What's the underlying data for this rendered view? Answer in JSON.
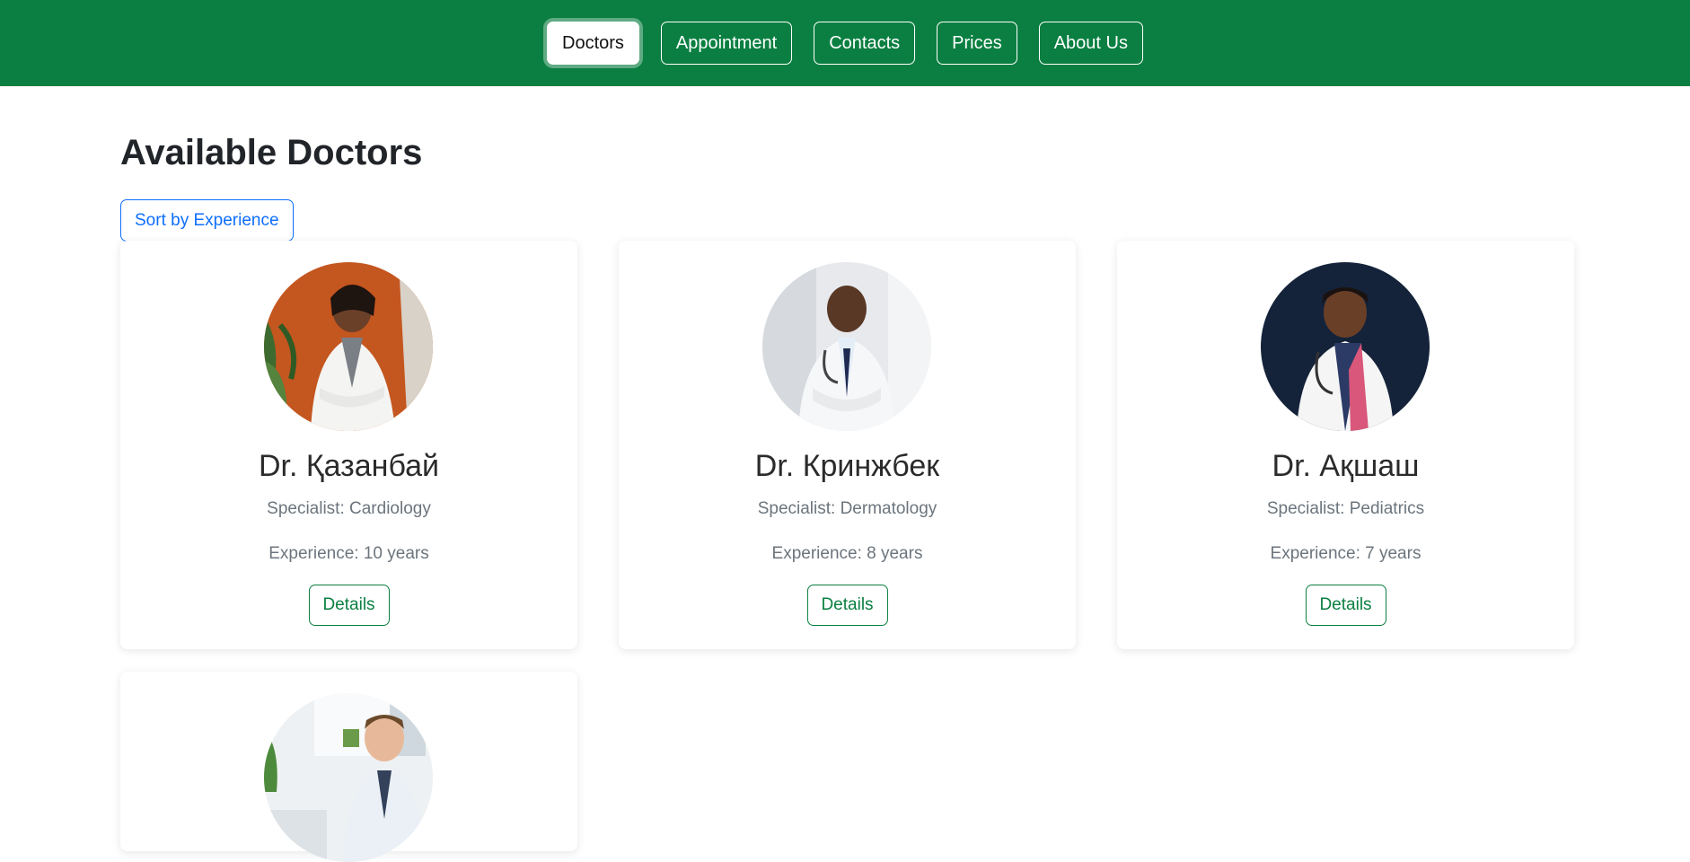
{
  "nav": {
    "items": [
      {
        "label": "Doctors",
        "active": true
      },
      {
        "label": "Appointment",
        "active": false
      },
      {
        "label": "Contacts",
        "active": false
      },
      {
        "label": "Prices",
        "active": false
      },
      {
        "label": "About Us",
        "active": false
      }
    ]
  },
  "main": {
    "title": "Available Doctors",
    "sort_label": "Sort by Experience"
  },
  "doctors": [
    {
      "name": "Dr. Қазанбай",
      "specialist": "Specialist: Cardiology",
      "experience": "Experience: 10 years",
      "details_label": "Details"
    },
    {
      "name": "Dr. Кринжбек",
      "specialist": "Specialist: Dermatology",
      "experience": "Experience: 8 years",
      "details_label": "Details"
    },
    {
      "name": "Dr. Ақшаш",
      "specialist": "Specialist: Pediatrics",
      "experience": "Experience: 7 years",
      "details_label": "Details"
    },
    {
      "name": "",
      "specialist": "",
      "experience": "",
      "details_label": ""
    }
  ],
  "colors": {
    "brand_green": "#0a7f41",
    "primary_blue": "#0d6efd"
  }
}
